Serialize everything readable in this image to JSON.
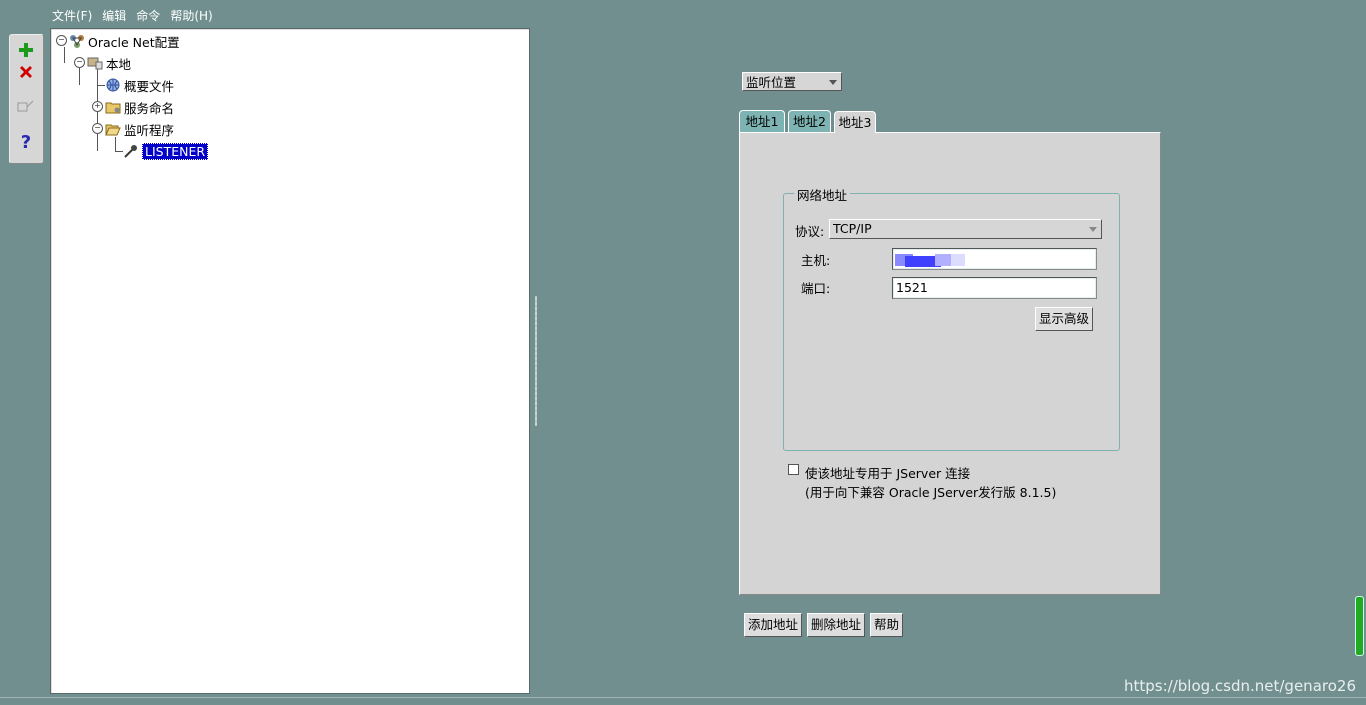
{
  "menu": [
    "文件(F)",
    "编辑",
    "命令",
    "帮助(H)"
  ],
  "toolbar": {
    "add_icon": "plus-icon",
    "delete_icon": "x-icon",
    "test_icon": "test-icon",
    "help_icon": "question-icon",
    "help_glyph": "?"
  },
  "tree": {
    "root": "Oracle Net配置",
    "local": "本地",
    "profile": "概要文件",
    "service_naming": "服务命名",
    "listeners": "监听程序",
    "listener": "LISTENER"
  },
  "location_select": "监听位置",
  "tabs": [
    "地址1",
    "地址2",
    "地址3"
  ],
  "active_tab": "地址3",
  "network": {
    "legend": "网络地址",
    "protocol_label": "协议:",
    "protocol_value": "TCP/IP",
    "host_label": "主机:",
    "host_value": "",
    "port_label": "端口:",
    "port_value": "1521",
    "advanced_button": "显示高级"
  },
  "jserver": {
    "checked": false,
    "label": "使该地址专用于 JServer 连接",
    "note": "(用于向下兼容 Oracle JServer发行版 8.1.5)"
  },
  "buttons": {
    "add": "添加地址",
    "remove": "删除地址",
    "help": "帮助"
  },
  "watermark": "https://blog.csdn.net/genaro26"
}
